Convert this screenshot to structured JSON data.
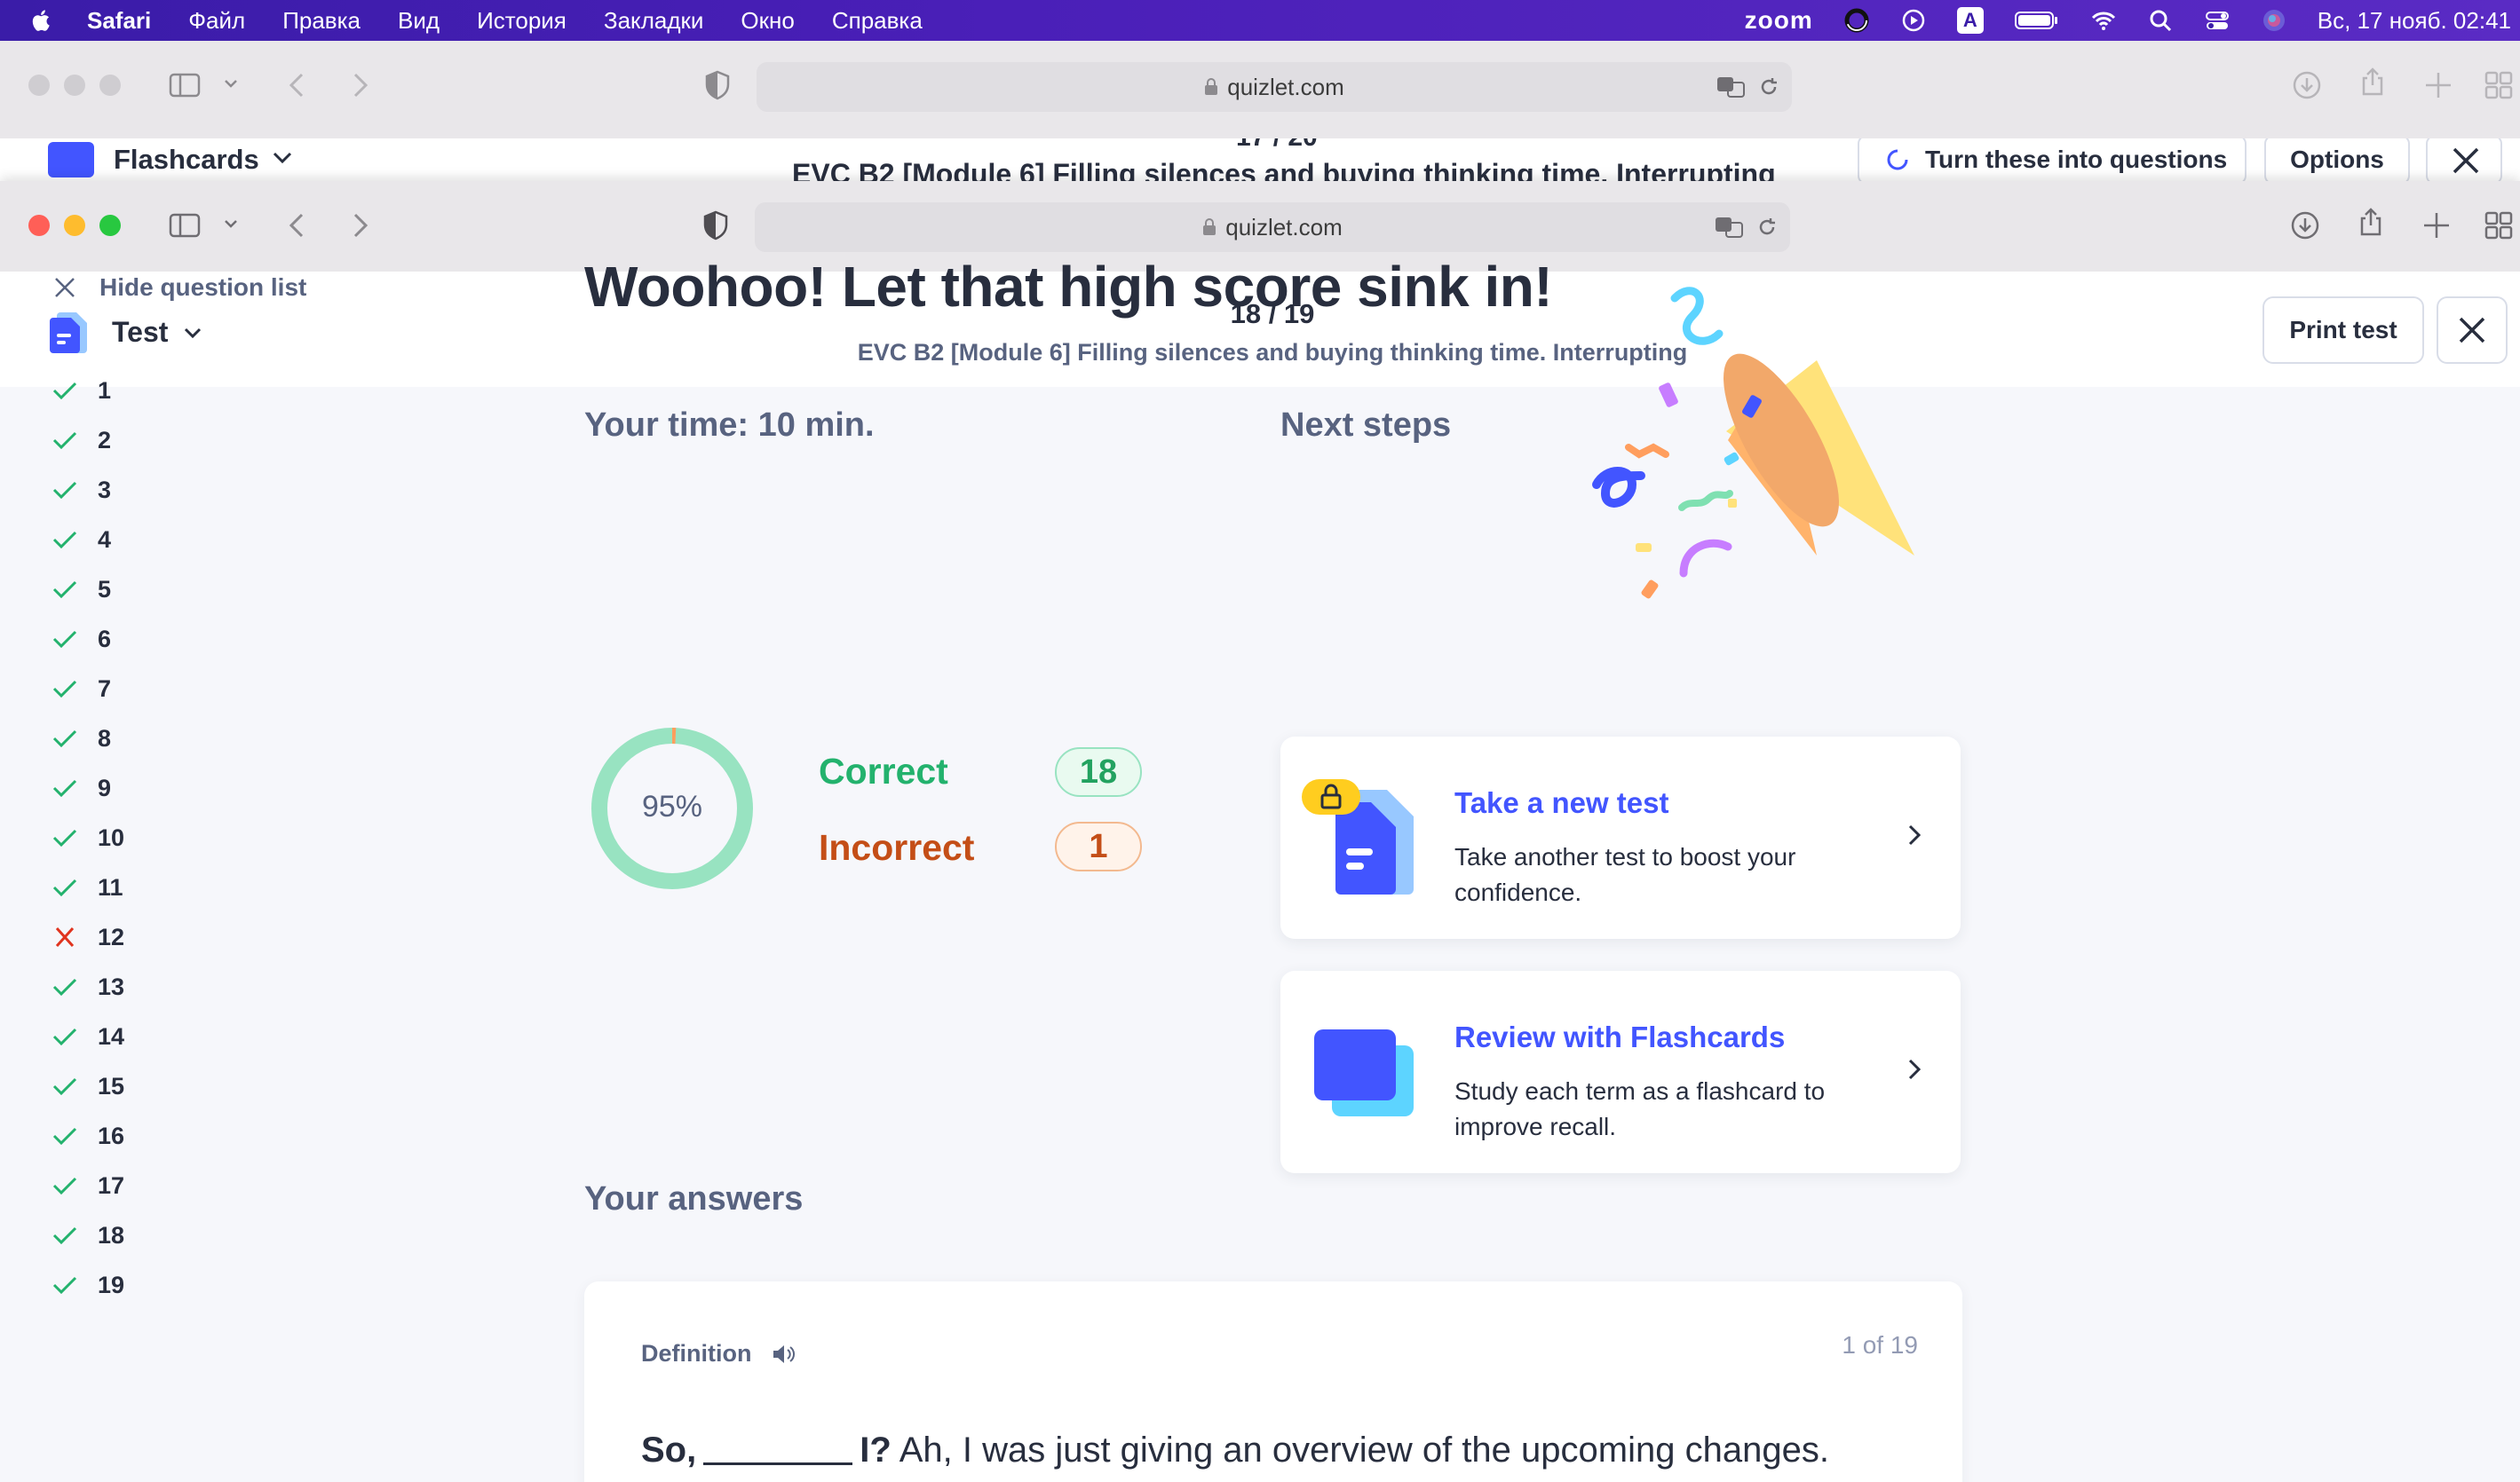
{
  "menubar": {
    "app": "Safari",
    "items": [
      "Файл",
      "Правка",
      "Вид",
      "История",
      "Закладки",
      "Окно",
      "Справка"
    ],
    "zoom": "zoom",
    "input_indicator": "A",
    "clock": "Вс, 17 нояб.  02:41"
  },
  "back_window": {
    "url": "quizlet.com",
    "app_label": "Flashcards",
    "count_cut": "17 / 20",
    "title_cut": "EVC B2 [Module 6] Filling silences and buying thinking time. Interrupting",
    "turn_button": "Turn these into questions",
    "options_button": "Options"
  },
  "browser": {
    "url": "quizlet.com"
  },
  "header": {
    "mode": "Test",
    "progress": "18 / 19",
    "set_title": "EVC B2 [Module 6] Filling silences and buying thinking time. Interrupting",
    "print_button": "Print test"
  },
  "sidebar": {
    "hide_label": "Hide question list",
    "questions": [
      {
        "n": "1",
        "status": "correct"
      },
      {
        "n": "2",
        "status": "correct"
      },
      {
        "n": "3",
        "status": "correct"
      },
      {
        "n": "4",
        "status": "correct"
      },
      {
        "n": "5",
        "status": "correct"
      },
      {
        "n": "6",
        "status": "correct"
      },
      {
        "n": "7",
        "status": "correct"
      },
      {
        "n": "8",
        "status": "correct"
      },
      {
        "n": "9",
        "status": "correct"
      },
      {
        "n": "10",
        "status": "correct"
      },
      {
        "n": "11",
        "status": "correct"
      },
      {
        "n": "12",
        "status": "incorrect"
      },
      {
        "n": "13",
        "status": "correct"
      },
      {
        "n": "14",
        "status": "correct"
      },
      {
        "n": "15",
        "status": "correct"
      },
      {
        "n": "16",
        "status": "correct"
      },
      {
        "n": "17",
        "status": "correct"
      },
      {
        "n": "18",
        "status": "correct"
      },
      {
        "n": "19",
        "status": "correct"
      }
    ]
  },
  "results": {
    "headline": "Woohoo! Let that high score sink in!",
    "time_label": "Your time: 10 min.",
    "score_percent": "95%",
    "score_fraction": 0.95,
    "correct_label": "Correct",
    "correct_count": "18",
    "incorrect_label": "Incorrect",
    "incorrect_count": "1"
  },
  "next_steps": {
    "heading": "Next steps",
    "cards": [
      {
        "title": "Take a new test",
        "desc": "Take another test to boost your confidence."
      },
      {
        "title": "Review with Flashcards",
        "desc": "Study each term as a flashcard to improve recall."
      }
    ]
  },
  "answers": {
    "heading": "Your answers",
    "first": {
      "label": "Definition",
      "position": "1 of 19",
      "q_before": "So,",
      "q_after_blank": "I?",
      "q_rest": " Ah, I was just giving an overview of the upcoming changes."
    }
  },
  "colors": {
    "accent": "#4255ff",
    "correct": "#23b26d",
    "incorrect": "#c44e17",
    "menubar": "#4a1fb8"
  }
}
